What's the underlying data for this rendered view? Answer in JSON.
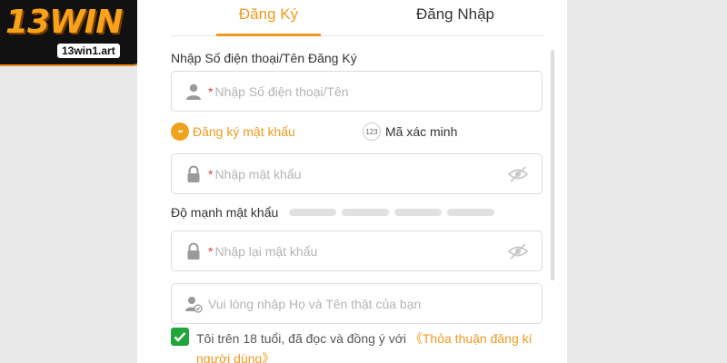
{
  "logo": {
    "brand": "13WIN",
    "url": "13win1.art"
  },
  "tabs": {
    "register": "Đăng Ký",
    "login": "Đăng Nhập"
  },
  "account": {
    "label": "Nhập Số điện thoại/Tên Đăng Ký",
    "required_mark": "*",
    "placeholder": "Nhập Số điện thoại/Tên"
  },
  "mode": {
    "password_option": "Đăng ký mật khẩu",
    "password_badge": "••",
    "otp_badge": "123",
    "otp_option": "Mã xác minh"
  },
  "password": {
    "required_mark": "*",
    "placeholder": "Nhập mật khẩu"
  },
  "strength": {
    "label": "Độ mạnh mật khẩu",
    "level": 0,
    "segments": 4
  },
  "confirm_password": {
    "required_mark": "*",
    "placeholder": "Nhập lại mật khẩu"
  },
  "full_name": {
    "placeholder": "Vui lòng nhập Họ và Tên thật của bạn"
  },
  "agreement": {
    "text": "Tôi trên 18 tuổi, đã đọc và đồng ý với ",
    "link": "《Thỏa thuận đăng kí người dùng》",
    "checked": true
  },
  "colors": {
    "accent": "#ef9a1f",
    "check": "#20a53a",
    "required": "#ee3b3b"
  }
}
